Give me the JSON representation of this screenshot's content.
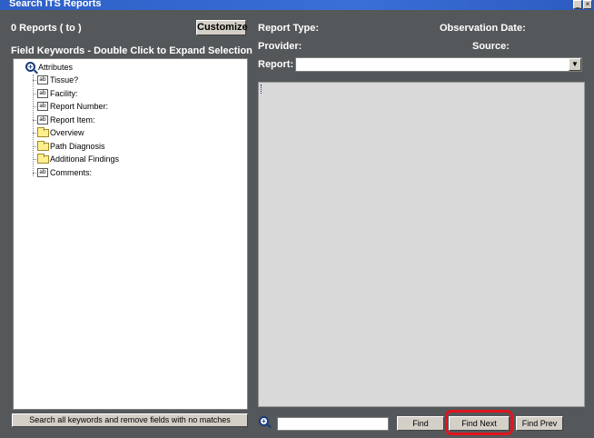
{
  "window": {
    "title": "Search ITS Reports",
    "title_buttons": [
      "_",
      "×"
    ]
  },
  "left": {
    "report_count": "0 Reports  ( to )",
    "customize_label": "Customize",
    "keywords_heading": "Field Keywords - Double Click to Expand Selection",
    "tree": {
      "root": "Attributes",
      "items": [
        {
          "label": "Tissue?",
          "icon": "text-field-icon"
        },
        {
          "label": "Facility:",
          "icon": "text-field-icon"
        },
        {
          "label": "Report Number:",
          "icon": "text-field-icon"
        },
        {
          "label": "Report Item:",
          "icon": "text-field-icon"
        },
        {
          "label": "Overview",
          "icon": "folder-icon"
        },
        {
          "label": "Path Diagnosis",
          "icon": "folder-icon"
        },
        {
          "label": "Additional Findings",
          "icon": "folder-icon"
        },
        {
          "label": "Comments:",
          "icon": "text-field-icon"
        }
      ]
    },
    "search_all_label": "Search all keywords and remove fields with no matches"
  },
  "right": {
    "report_type_label": "Report Type:",
    "observation_date_label": "Observation Date:",
    "provider_label": "Provider:",
    "source_label": "Source:",
    "report_label": "Report:",
    "report_value": "",
    "find_value": "",
    "find_label": "Find",
    "find_next_label": "Find Next",
    "find_prev_label": "Find Prev"
  },
  "colors": {
    "background": "#54585a",
    "titlebar": "#2d5fc6",
    "highlight": "#e0141e",
    "report_view": "#d9d9d9"
  }
}
